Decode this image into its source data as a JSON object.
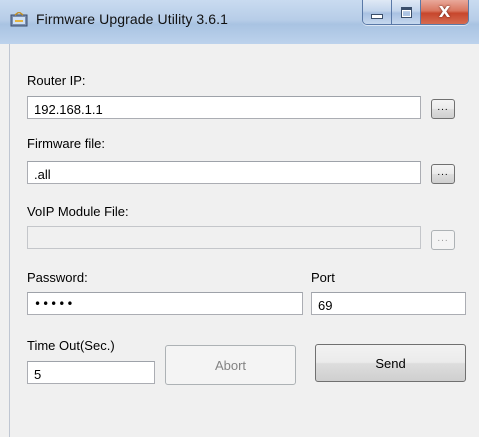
{
  "window": {
    "title": "Firmware Upgrade Utility 3.6.1",
    "controls": {
      "minimize": "minimize-icon",
      "maximize": "maximize-icon",
      "close": "close-icon"
    }
  },
  "form": {
    "router_ip": {
      "label": "Router IP:",
      "value": "192.168.1.1",
      "browse_label": "..."
    },
    "firmware_file": {
      "label": "Firmware file:",
      "value": ".all",
      "browse_label": "..."
    },
    "voip_module_file": {
      "label": "VoIP Module File:",
      "value": "",
      "browse_label": "...",
      "enabled": false
    },
    "password": {
      "label": "Password:",
      "value": "•••••"
    },
    "port": {
      "label": "Port",
      "value": "69"
    },
    "timeout": {
      "label": "Time Out(Sec.)",
      "value": "5"
    },
    "buttons": {
      "abort": "Abort",
      "send": "Send"
    }
  },
  "colors": {
    "titlebar": "#b7cde8",
    "close_button": "#c7472d",
    "window_bg": "#f0f0f0"
  }
}
